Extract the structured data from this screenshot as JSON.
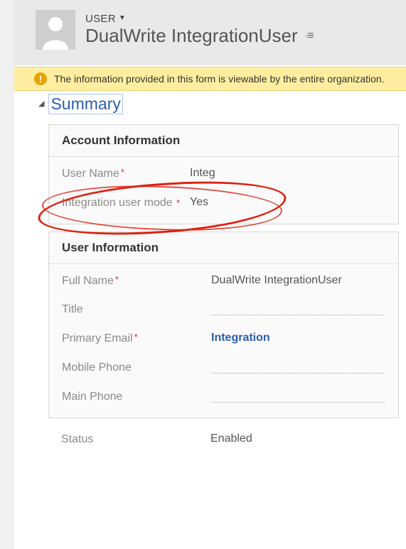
{
  "header": {
    "entity_type": "USER",
    "entity_name": "DualWrite IntegrationUser"
  },
  "notification": {
    "text": "The information provided in this form is viewable by the entire organization."
  },
  "section_title": "Summary",
  "account_info": {
    "title": "Account Information",
    "user_name_label": "User Name",
    "user_name_value": "Integ",
    "integration_label": "Integration user mode",
    "integration_value": "Yes"
  },
  "user_info": {
    "title": "User Information",
    "full_name_label": "Full Name",
    "full_name_value": "DualWrite IntegrationUser",
    "title_label": "Title",
    "primary_email_label": "Primary Email",
    "primary_email_value": "Integration",
    "mobile_phone_label": "Mobile Phone",
    "main_phone_label": "Main Phone"
  },
  "status": {
    "label": "Status",
    "value": "Enabled"
  }
}
